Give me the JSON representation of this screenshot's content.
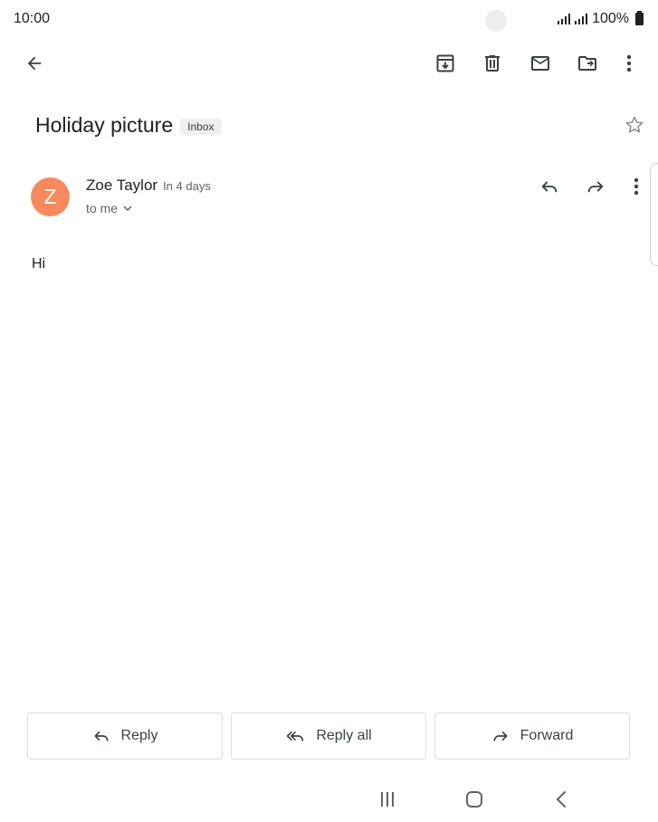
{
  "status_bar": {
    "time": "10:00",
    "battery": "100%",
    "icons": [
      "signal-icon",
      "signal-icon",
      "battery-icon"
    ]
  },
  "toolbar": {
    "icons": [
      "back-arrow-icon",
      "archive-icon",
      "delete-icon",
      "mark-unread-icon",
      "move-to-icon",
      "more-vert-icon"
    ]
  },
  "email": {
    "subject": "Holiday picture",
    "label": "Inbox",
    "sender": {
      "initial": "Z",
      "name": "Zoe Taylor",
      "time": "In 4 days",
      "recipient": "to me",
      "avatar_color": "#f68a5e"
    },
    "body": "Hi"
  },
  "actions": {
    "reply": "Reply",
    "reply_all": "Reply all",
    "forward": "Forward"
  },
  "nav": {
    "icons": [
      "recent-apps-icon",
      "home-icon",
      "back-icon"
    ]
  }
}
